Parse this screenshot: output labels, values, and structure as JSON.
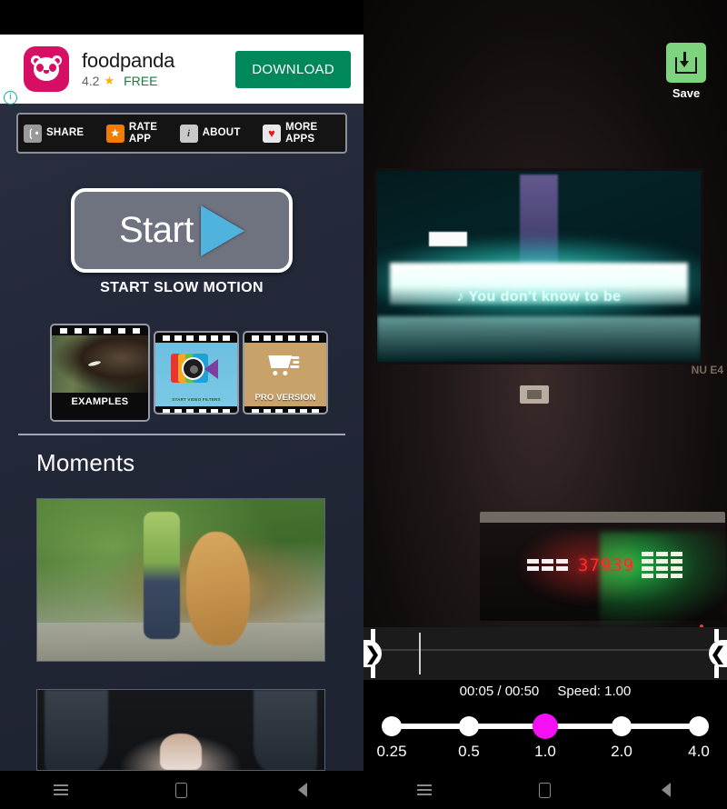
{
  "left_app": {
    "ad": {
      "icon_name": "foodpanda-logo-icon",
      "title": "foodpanda",
      "rating": "4.2",
      "star": "★",
      "price": "FREE",
      "download_label": "DOWNLOAD",
      "info_glyph": "i",
      "button_color": "#00875a",
      "brand_color": "#d70f64"
    },
    "action_bar": [
      {
        "label": "SHARE",
        "icon": "share-icon",
        "icon_glyph": "≪",
        "icon_color": "#9a9a9a"
      },
      {
        "label": "RATE\nAPP",
        "icon": "star-icon",
        "icon_glyph": "★",
        "icon_color": "#f07c00"
      },
      {
        "label": "ABOUT",
        "icon": "info-icon",
        "icon_glyph": "i",
        "icon_color": "#c9c9c9"
      },
      {
        "label": "MORE\nAPPS",
        "icon": "heart-icon",
        "icon_glyph": "♥",
        "icon_color": "#e01b24"
      }
    ],
    "start": {
      "button_label": "Start",
      "play_icon": "play-triangle-icon",
      "caption": "START SLOW MOTION",
      "accent_color": "#4fb3dd"
    },
    "cards": [
      {
        "label": "EXAMPLES",
        "name": "examples-card"
      },
      {
        "label": "START VIDEO FILTERS",
        "name": "video-filters-card"
      },
      {
        "label": "PRO VERSION",
        "name": "pro-version-card"
      }
    ],
    "moments": {
      "title": "Moments",
      "items": [
        {
          "name": "moment-dog-park",
          "alt": "Golden retriever jumping on person in park"
        },
        {
          "name": "moment-hands-dark",
          "alt": "Dark photo of hands"
        }
      ]
    }
  },
  "right_app": {
    "save": {
      "label": "Save",
      "icon": "save-download-icon",
      "button_color": "#7ed37e"
    },
    "video": {
      "lyric_overlay": "♪ You don't know to be",
      "led_number": "37939",
      "wall_text": "NU\nE4"
    },
    "timeline": {
      "left_handle_glyph": "❯",
      "right_handle_glyph": "❮",
      "playhead_position_pct": 15
    },
    "playback": {
      "current_time": "00:05",
      "separator": "/",
      "total_time": "00:50",
      "time_display": "00:05 / 00:50",
      "speed_display": "Speed: 1.00"
    },
    "speed_slider": {
      "selected": "1.0",
      "active_color": "#f50ff5",
      "stops": [
        {
          "label": "0.25",
          "value": 0.25,
          "pos_pct": 0
        },
        {
          "label": "0.5",
          "value": 0.5,
          "pos_pct": 25
        },
        {
          "label": "1.0",
          "value": 1.0,
          "pos_pct": 50
        },
        {
          "label": "2.0",
          "value": 2.0,
          "pos_pct": 75
        },
        {
          "label": "4.0",
          "value": 4.0,
          "pos_pct": 100
        }
      ]
    }
  },
  "navbar": {
    "menu": "menu-icon",
    "home": "home-icon",
    "back": "back-icon"
  }
}
